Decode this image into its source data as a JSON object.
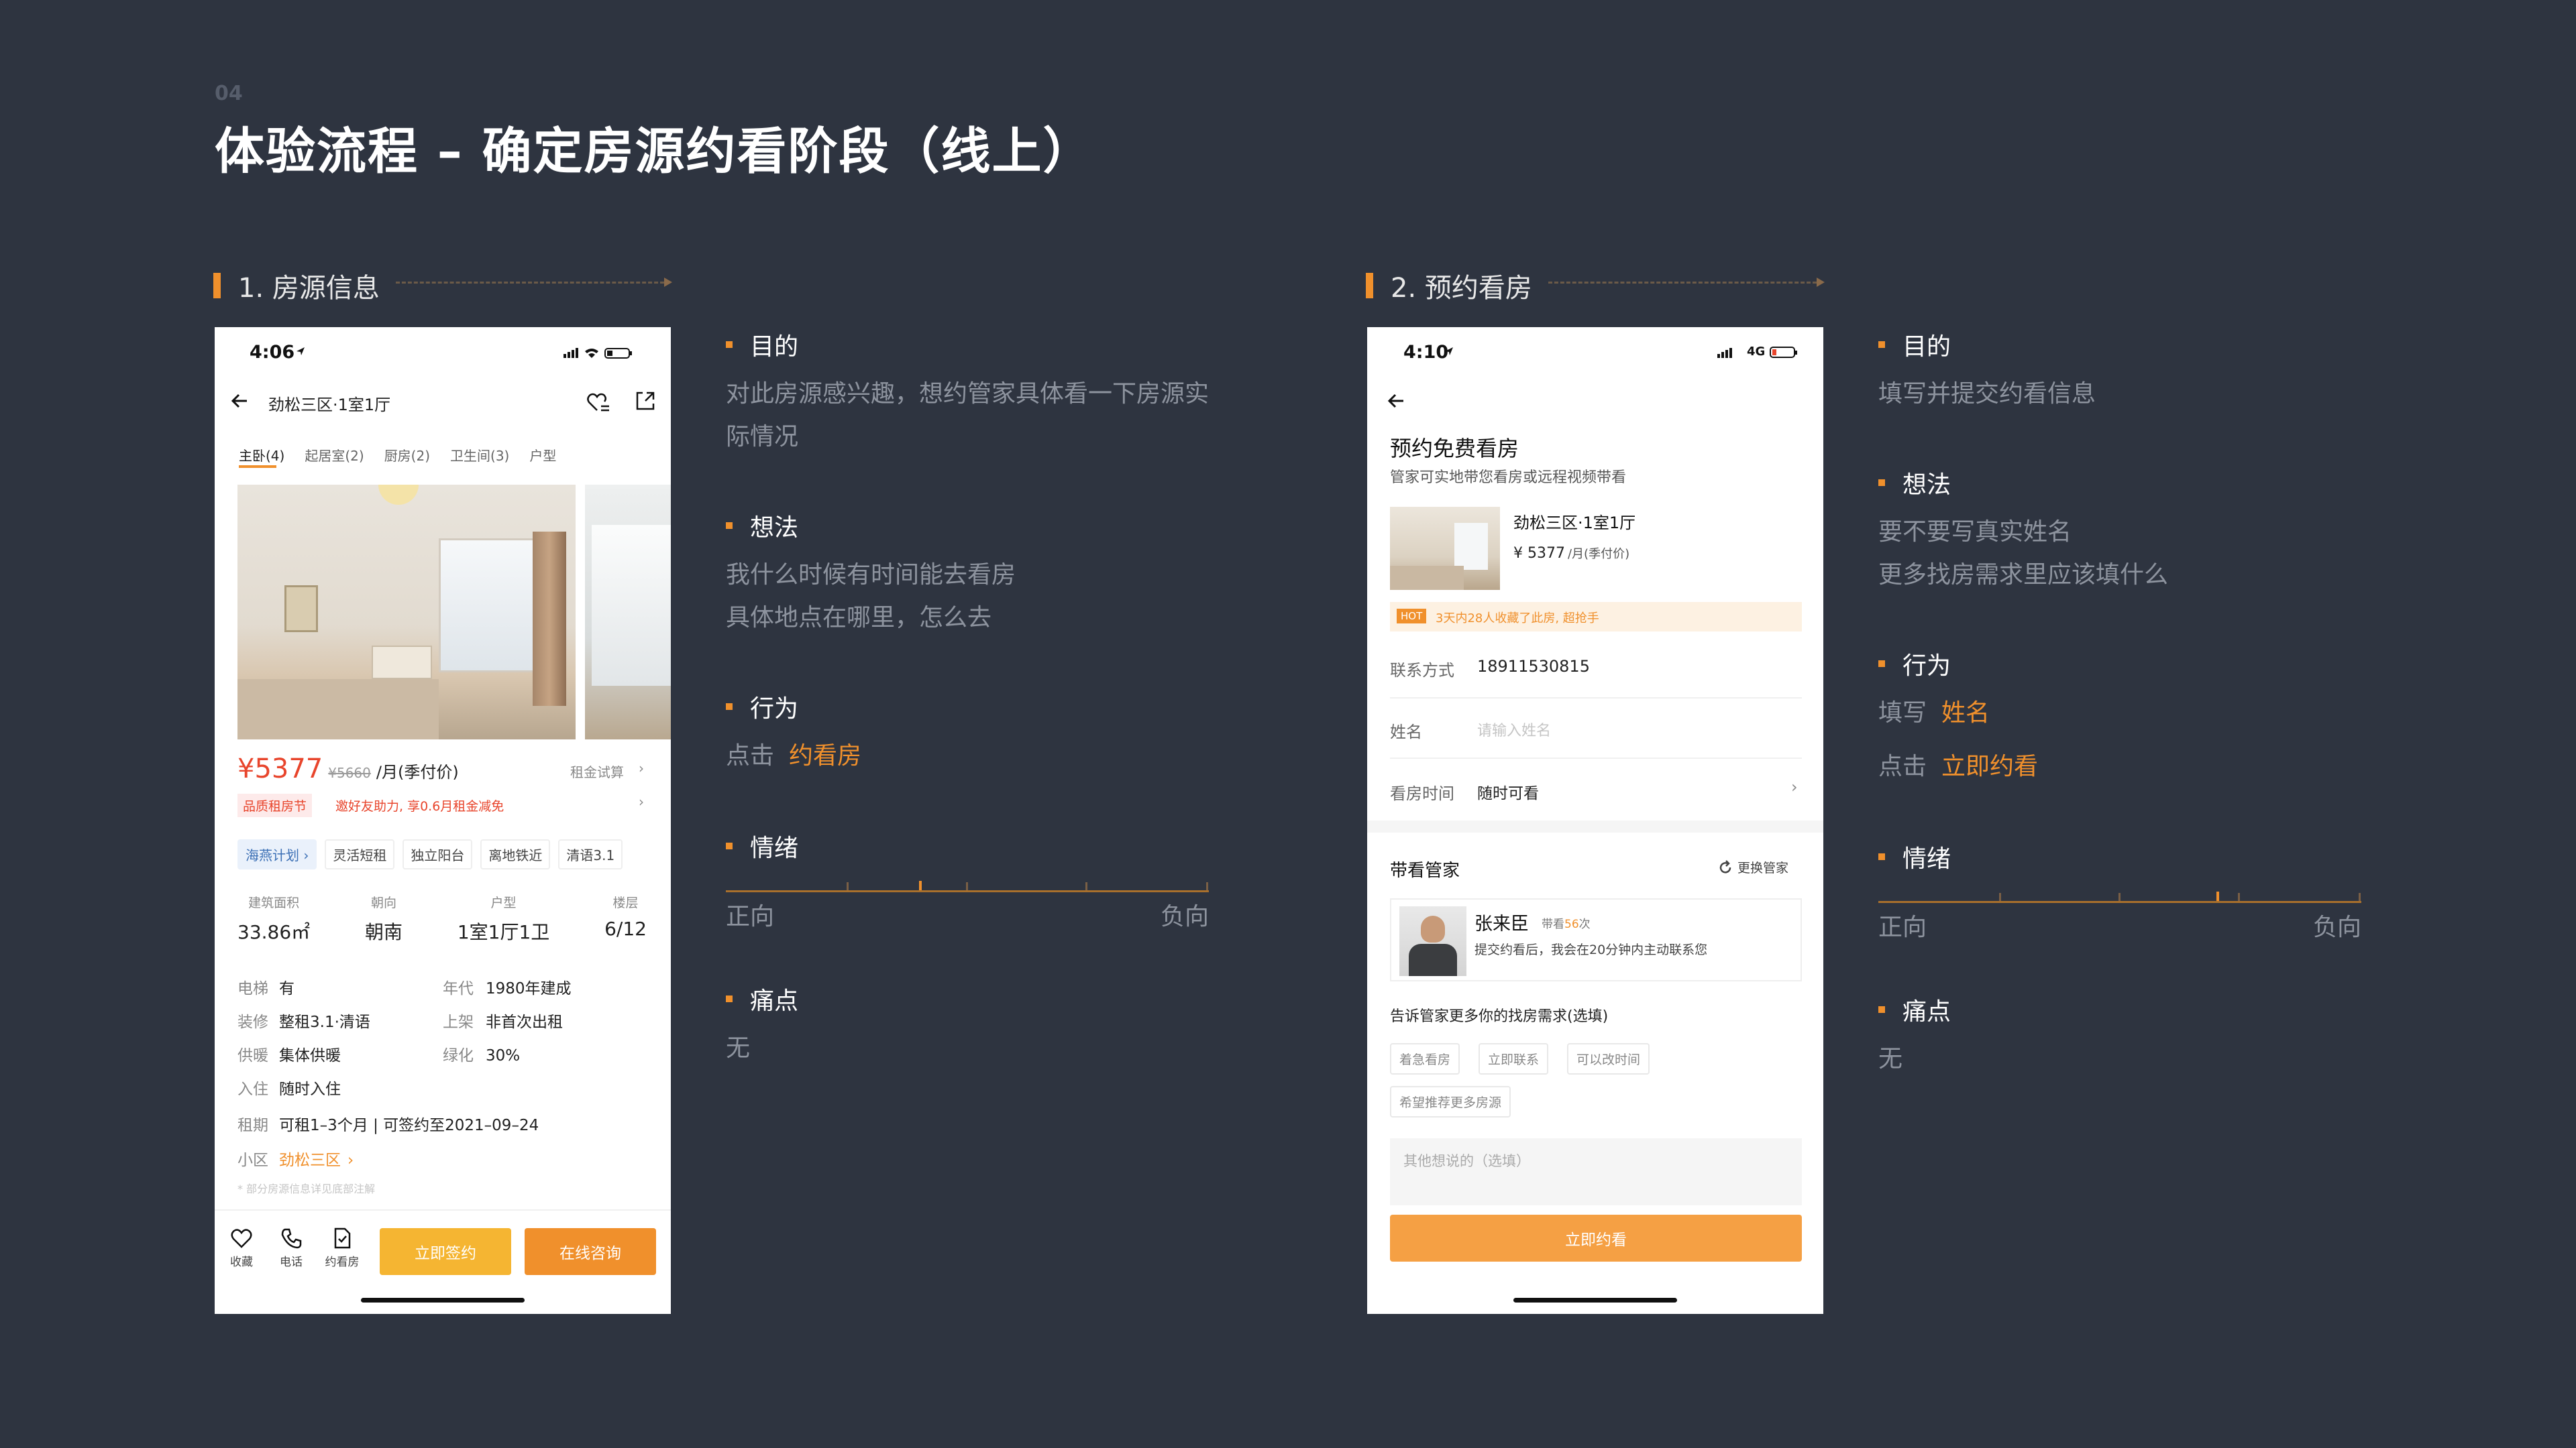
{
  "page": {
    "number": "04",
    "title": "体验流程 – 确定房源约看阶段（线上）"
  },
  "section1": {
    "title": "1. 房源信息"
  },
  "section2": {
    "title": "2. 预约看房"
  },
  "phone1": {
    "status_time": "4:06",
    "nav_title": "劲松三区·1室1厅",
    "tabs": [
      "主卧(4)",
      "起居室(2)",
      "厨房(2)",
      "卫生间(3)",
      "户型"
    ],
    "price": "¥5377",
    "price_old": "¥5660",
    "price_unit": "/月(季付价)",
    "price_calc": "租金试算",
    "promo_tag": "品质租房节",
    "promo_text": "邀好友助力, 享0.6月租金减免",
    "tags": [
      "海燕计划",
      "灵活短租",
      "独立阳台",
      "离地铁近",
      "清语3.1"
    ],
    "specs": [
      {
        "label": "建筑面积",
        "value": "33.86㎡"
      },
      {
        "label": "朝向",
        "value": "朝南"
      },
      {
        "label": "户型",
        "value": "1室1厅1卫"
      },
      {
        "label": "楼层",
        "value": "6/12"
      }
    ],
    "details": {
      "elevator_label": "电梯",
      "elevator_value": "有",
      "year_label": "年代",
      "year_value": "1980年建成",
      "decor_label": "装修",
      "decor_value": "整租3.1·清语",
      "listed_label": "上架",
      "listed_value": "非首次出租",
      "heating_label": "供暖",
      "heating_value": "集体供暖",
      "green_label": "绿化",
      "green_value": "30%",
      "checkin_label": "入住",
      "checkin_value": "随时入住",
      "lease_label": "租期",
      "lease_value": "可租1–3个月 | 可签约至2021–09–24",
      "community_label": "小区",
      "community_value": "劲松三区",
      "footnote": "* 部分房源信息详见底部注解"
    },
    "bottom": {
      "fav": "收藏",
      "phone": "电话",
      "book": "约看房",
      "sign": "立即签约",
      "consult": "在线咨询"
    }
  },
  "phone2": {
    "status_time": "4:10",
    "network": "4G",
    "title": "预约免费看房",
    "subtitle": "管家可实地带您看房或远程视频带看",
    "listing_name": "劲松三区·1室1厅",
    "listing_price": "¥ 5377",
    "listing_unit": "/月(季付价)",
    "hot_badge": "HOT",
    "hot_text": "3天内28人收藏了此房, 超抢手",
    "contact_label": "联系方式",
    "contact_value": "18911530815",
    "name_label": "姓名",
    "name_placeholder": "请输入姓名",
    "time_label": "看房时间",
    "time_value": "随时可看",
    "agent_section": "带看管家",
    "change_agent": "更换管家",
    "agent_name": "张来臣",
    "agent_count_prefix": "带看",
    "agent_count": "56",
    "agent_count_suffix": "次",
    "agent_desc": "提交约看后，我会在20分钟内主动联系您",
    "needs_title": "告诉管家更多你的找房需求(选填)",
    "need_tags": [
      "着急看房",
      "立即联系",
      "可以改时间",
      "希望推荐更多房源"
    ],
    "other_placeholder": "其他想说的（选填）",
    "submit": "立即约看"
  },
  "notes1": {
    "goal_h": "目的",
    "goal_1": "对此房源感兴趣，想约管家具体看一下房源实",
    "goal_2": "际情况",
    "thought_h": "想法",
    "thought_1": "我什么时候有时间能去看房",
    "thought_2": "具体地点在哪里，怎么去",
    "action_h": "行为",
    "action_1a": "点击",
    "action_1b": "约看房",
    "emotion_h": "情绪",
    "emotion_pos": "正向",
    "emotion_neg": "负向",
    "emotion_level": 0.4,
    "pain_h": "痛点",
    "pain_1": "无"
  },
  "notes2": {
    "goal_h": "目的",
    "goal_1": "填写并提交约看信息",
    "thought_h": "想法",
    "thought_1": "要不要写真实姓名",
    "thought_2": "更多找房需求里应该填什么",
    "action_h": "行为",
    "action_1a": "填写",
    "action_1b": "姓名",
    "action_2a": "点击",
    "action_2b": "立即约看",
    "emotion_h": "情绪",
    "emotion_pos": "正向",
    "emotion_neg": "负向",
    "emotion_level": 0.7,
    "pain_h": "痛点",
    "pain_1": "无"
  },
  "colors": {
    "background": "#2e3440",
    "accent": "#f0902c",
    "price_red": "#e8452c",
    "button_yellow": "#f5b532"
  }
}
